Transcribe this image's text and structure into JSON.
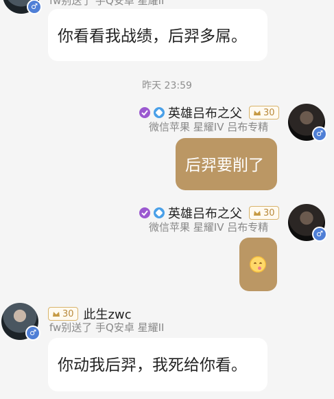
{
  "top_partial": {
    "meta_text": "fw别送了 手Q安卓 星耀II",
    "message": "你看看我战绩，后羿多屌。"
  },
  "timestamp": "昨天 23:59",
  "messages": [
    {
      "sender": "英雄吕布之父",
      "level": "30",
      "meta": "微信苹果 星耀IV 吕布专精",
      "text": "后羿要削了"
    },
    {
      "sender": "英雄吕布之父",
      "level": "30",
      "meta": "微信苹果 星耀IV 吕布专精",
      "emoji": "smiling-tongue-emoji"
    },
    {
      "sender": "此生zwc",
      "level": "30",
      "meta": "fw别送了 手Q安卓 星耀II",
      "text": "你动我后羿，我死给你看。"
    }
  ],
  "colors": {
    "background": "#f5f5f5",
    "outgoing_bubble": "#bb9764",
    "incoming_bubble": "#ffffff",
    "badge_gold": "#d8b36a",
    "gender_blue": "#4f7fd6"
  }
}
